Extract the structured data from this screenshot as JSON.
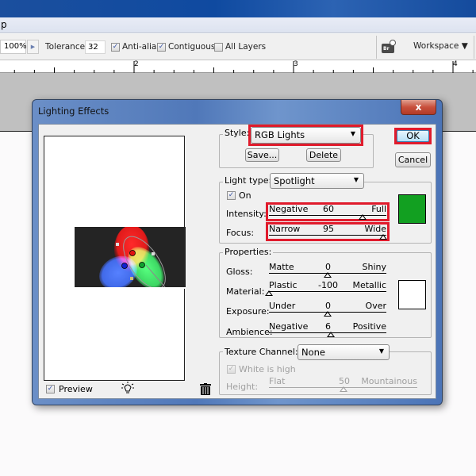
{
  "app": {
    "menu_fragment": "p",
    "options_bar": {
      "zoom_value": "100%",
      "tolerance_label": "Tolerance:",
      "tolerance_value": "32",
      "anti_alias": {
        "label": "Anti-alias",
        "checked": true
      },
      "contiguous": {
        "label": "Contiguous",
        "checked": true
      },
      "all_layers": {
        "label": "All Layers",
        "checked": false
      },
      "bridge_icon_text": "Br",
      "workspace_label": "Workspace ▼"
    },
    "ruler": {
      "labels": [
        "2",
        "3",
        "4"
      ]
    }
  },
  "dialog": {
    "title": "Lighting Effects",
    "close_label": "x",
    "style": {
      "label": "Style:",
      "value": "RGB Lights",
      "save_label": "Save...",
      "delete_label": "Delete"
    },
    "ok_label": "OK",
    "cancel_label": "Cancel",
    "light": {
      "type_label": "Light type:",
      "type_value": "Spotlight",
      "on_label": "On",
      "on_checked": true,
      "color": "#12a021",
      "intensity": {
        "label": "Intensity:",
        "left": "Negative",
        "value": "60",
        "right": "Full",
        "min": -100,
        "max": 100
      },
      "focus": {
        "label": "Focus:",
        "left": "Narrow",
        "value": "95",
        "right": "Wide",
        "min": -100,
        "max": 100
      }
    },
    "properties": {
      "label": "Properties:",
      "color": "#ffffff",
      "gloss": {
        "label": "Gloss:",
        "left": "Matte",
        "value": "0",
        "right": "Shiny",
        "min": -100,
        "max": 100
      },
      "material": {
        "label": "Material:",
        "left": "Plastic",
        "value": "-100",
        "right": "Metallic",
        "min": -100,
        "max": 100
      },
      "exposure": {
        "label": "Exposure:",
        "left": "Under",
        "value": "0",
        "right": "Over",
        "min": -100,
        "max": 100
      },
      "ambience": {
        "label": "Ambience:",
        "left": "Negative",
        "value": "6",
        "right": "Positive",
        "min": -100,
        "max": 100
      }
    },
    "texture": {
      "label": "Texture Channel:",
      "value": "None",
      "white_is_high_label": "White is high",
      "white_is_high_checked": true,
      "height": {
        "label": "Height:",
        "left": "Flat",
        "value": "50",
        "right": "Mountainous",
        "min": 0,
        "max": 100
      }
    },
    "preview": {
      "label": "Preview",
      "checked": true,
      "lights": [
        {
          "name": "red",
          "color": "#ff2020"
        },
        {
          "name": "green",
          "color": "#20ff50"
        },
        {
          "name": "blue",
          "color": "#2050ff"
        }
      ]
    }
  }
}
